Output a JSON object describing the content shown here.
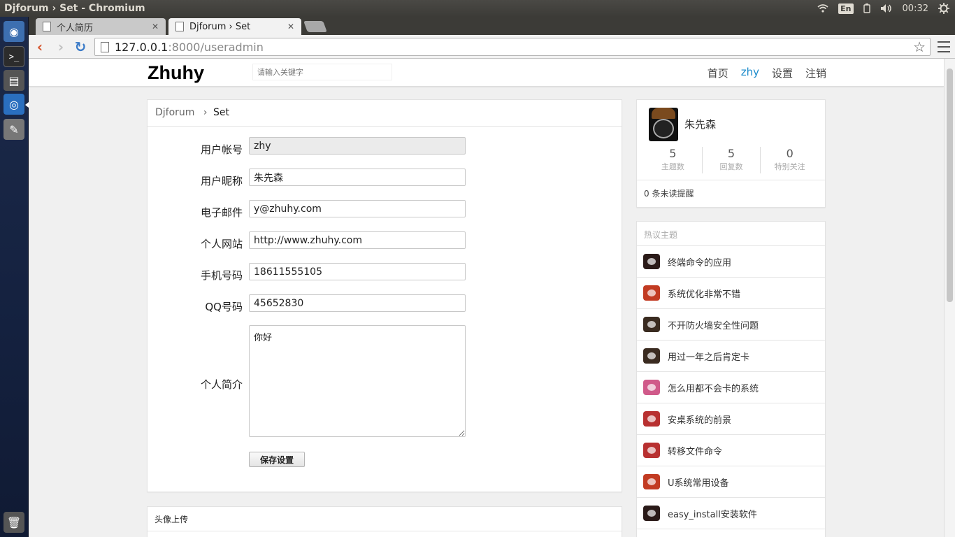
{
  "os": {
    "window_title": "Djforum › Set - Chromium",
    "keyboard": "En",
    "clock": "00:32"
  },
  "browser": {
    "tabs": [
      {
        "label": "个人简历"
      },
      {
        "label": "Djforum › Set"
      }
    ],
    "url_host": "127.0.0.1",
    "url_path": ":8000/useradmin"
  },
  "site": {
    "logo": "Zhuhy",
    "search_placeholder": "请输入关键字",
    "nav": [
      "首页",
      "zhy",
      "设置",
      "注销"
    ]
  },
  "breadcrumb": {
    "home": "Djforum",
    "sep": "›",
    "current": "Set"
  },
  "form": {
    "fields": [
      {
        "label": "用户帐号",
        "value": "zhy"
      },
      {
        "label": "用户昵称",
        "value": "朱先森"
      },
      {
        "label": "电子邮件",
        "value": "y@zhuhy.com"
      },
      {
        "label": "个人网站",
        "value": "http://www.zhuhy.com"
      },
      {
        "label": "手机号码",
        "value": "18611555105"
      },
      {
        "label": "QQ号码",
        "value": "45652830"
      }
    ],
    "bio_label": "个人简介",
    "bio_value": "你好",
    "save_label": "保存设置"
  },
  "avatar_upload": {
    "title": "头像上传"
  },
  "user": {
    "name": "朱先森",
    "stats": [
      {
        "num": "5",
        "label": "主题数"
      },
      {
        "num": "5",
        "label": "回复数"
      },
      {
        "num": "0",
        "label": "特别关注"
      }
    ],
    "notice": "0 条未读提醒"
  },
  "hot": {
    "title": "热议主题",
    "items": [
      {
        "title": "终端命令的应用",
        "color": "#2a1a18"
      },
      {
        "title": "系统优化非常不错",
        "color": "#c23b22"
      },
      {
        "title": "不开防火墙安全性问题",
        "color": "#3a2b20"
      },
      {
        "title": "用过一年之后肯定卡",
        "color": "#3a2b20"
      },
      {
        "title": "怎么用都不会卡的系统",
        "color": "#d05a8a"
      },
      {
        "title": "安桌系统的前景",
        "color": "#b83030"
      },
      {
        "title": "转移文件命令",
        "color": "#b83030"
      },
      {
        "title": "U系统常用设备",
        "color": "#c23b22"
      },
      {
        "title": "easy_install安装软件",
        "color": "#2a1a18"
      }
    ]
  },
  "colors": {
    "accent": "#1a8acb",
    "launcher": "#14213f",
    "panel": "#3c3b37"
  }
}
